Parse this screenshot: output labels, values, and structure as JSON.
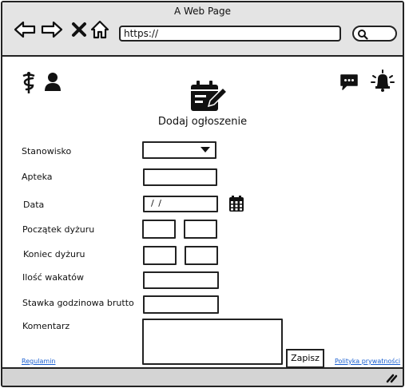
{
  "window": {
    "title": "A Web Page"
  },
  "browser": {
    "url": "https://",
    "icons": [
      "back-arrow-icon",
      "forward-arrow-icon",
      "close-x-icon",
      "home-icon",
      "search-icon"
    ]
  },
  "header": {
    "left_icons": [
      "caduceus-icon",
      "user-icon"
    ],
    "right_icons": [
      "chat-icon",
      "bell-icon"
    ],
    "main_icon": "calendar-edit-icon",
    "title": "Dodaj ogłoszenie"
  },
  "form": {
    "stanowisko_label": "Stanowisko",
    "apteka_label": "Apteka",
    "data_label": "Data",
    "data_value": "/ /",
    "poczatek_label": "Początek dyżuru",
    "koniec_label": "Koniec dyżuru",
    "wakaty_label": "Ilość wakatów",
    "stawka_label": "Stawka godzinowa brutto",
    "komentarz_label": "Komentarz",
    "save_label": "Zapisz"
  },
  "footer": {
    "regulamin_label": "Regulamin",
    "polityka_label": "Polityka prywatności"
  },
  "colors": {
    "link": "#1a5fd0",
    "chrome": "#e4e4e4",
    "status_bar": "#d4d4d4"
  }
}
